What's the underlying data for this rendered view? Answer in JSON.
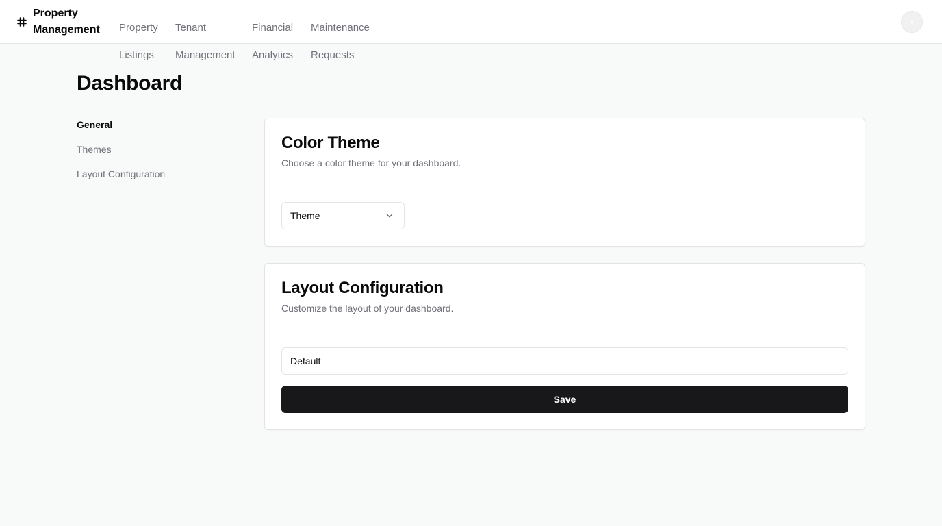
{
  "header": {
    "brand_line1": "Property",
    "brand_line2": "Management",
    "brand_icon": "hash-icon",
    "nav": [
      {
        "line1": "Property",
        "line2": "Listings"
      },
      {
        "line1": "Tenant",
        "line2": "Management"
      },
      {
        "line1": "Financial",
        "line2": "Analytics"
      },
      {
        "line1": "Maintenance",
        "line2": "Requests"
      }
    ],
    "avatar": "user-avatar"
  },
  "page": {
    "title": "Dashboard"
  },
  "sidebar": {
    "items": [
      {
        "label": "General",
        "active": true
      },
      {
        "label": "Themes",
        "active": false
      },
      {
        "label": "Layout Configuration",
        "active": false
      }
    ]
  },
  "color_theme": {
    "title": "Color Theme",
    "description": "Choose a color theme for your dashboard.",
    "select_value": "Theme"
  },
  "layout_config": {
    "title": "Layout Configuration",
    "description": "Customize the layout of your dashboard.",
    "input_value": "Default",
    "save_label": "Save"
  },
  "colors": {
    "background": "#f8f9f9",
    "primary_button": "#18181b",
    "muted_text": "#71717a",
    "border": "#e4e4e7"
  }
}
